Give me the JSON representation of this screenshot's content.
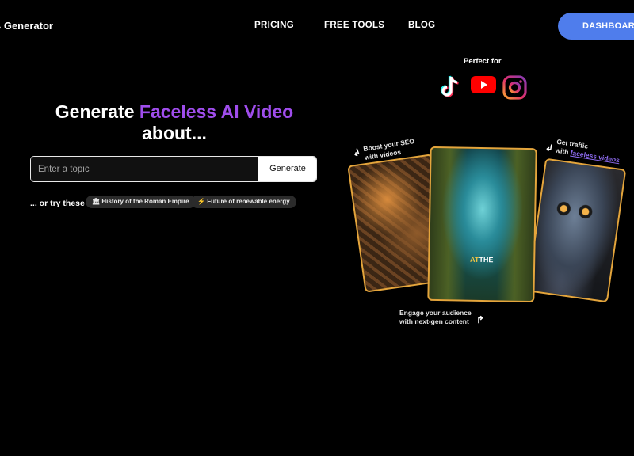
{
  "header": {
    "brand": "s Generator",
    "nav": [
      "PRICING",
      "FREE TOOLS",
      "BLOG"
    ],
    "dashboard_label": "DASHBOARD"
  },
  "hero": {
    "title_prefix": "Generate",
    "title_accent": "Faceless AI Video",
    "title_line2": "about...",
    "input_placeholder": "Enter a topic",
    "generate_label": "Generate",
    "try_label": "... or try these",
    "suggestions": [
      {
        "icon": "🏛",
        "label": "History of the Roman Empire"
      },
      {
        "icon": "⚡",
        "label": "Future of renewable energy"
      }
    ]
  },
  "showcase": {
    "perfect_for": "Perfect for",
    "platforms": [
      "tiktok-icon",
      "youtube-icon",
      "instagram-icon"
    ],
    "caption_hl": "AT",
    "caption_rest": "THE",
    "note_left_1": "Boost your SEO",
    "note_left_2": "with videos",
    "note_right_1": "Get traffic",
    "note_right_2a": "with",
    "note_right_2b": "faceless videos",
    "note_bottom_1": "Engage your audience",
    "note_bottom_2": "with next-gen content"
  },
  "colors": {
    "accent_purple": "#9f4dec",
    "dashboard_blue": "#4f7dec",
    "card_border": "#e4a53c"
  }
}
